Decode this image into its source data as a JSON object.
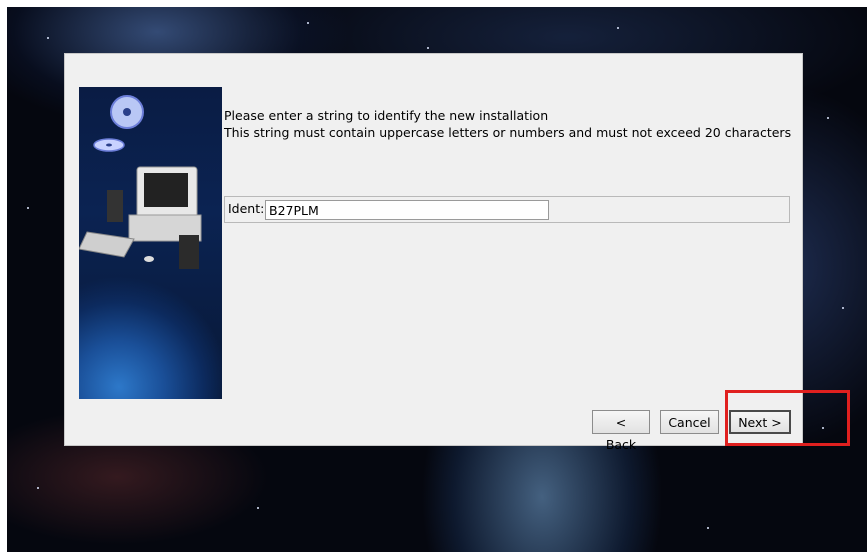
{
  "dialog": {
    "instructions": [
      "Please enter a string to identify the new installation",
      "This string must contain uppercase letters or numbers and must not exceed 20 characters"
    ],
    "ident": {
      "label": "Ident:",
      "value": "B27PLM"
    },
    "buttons": {
      "back": "< Back",
      "cancel": "Cancel",
      "next": "Next >"
    }
  },
  "colors": {
    "highlight": "#e0201f",
    "dialog_bg": "#f0f0f0"
  }
}
